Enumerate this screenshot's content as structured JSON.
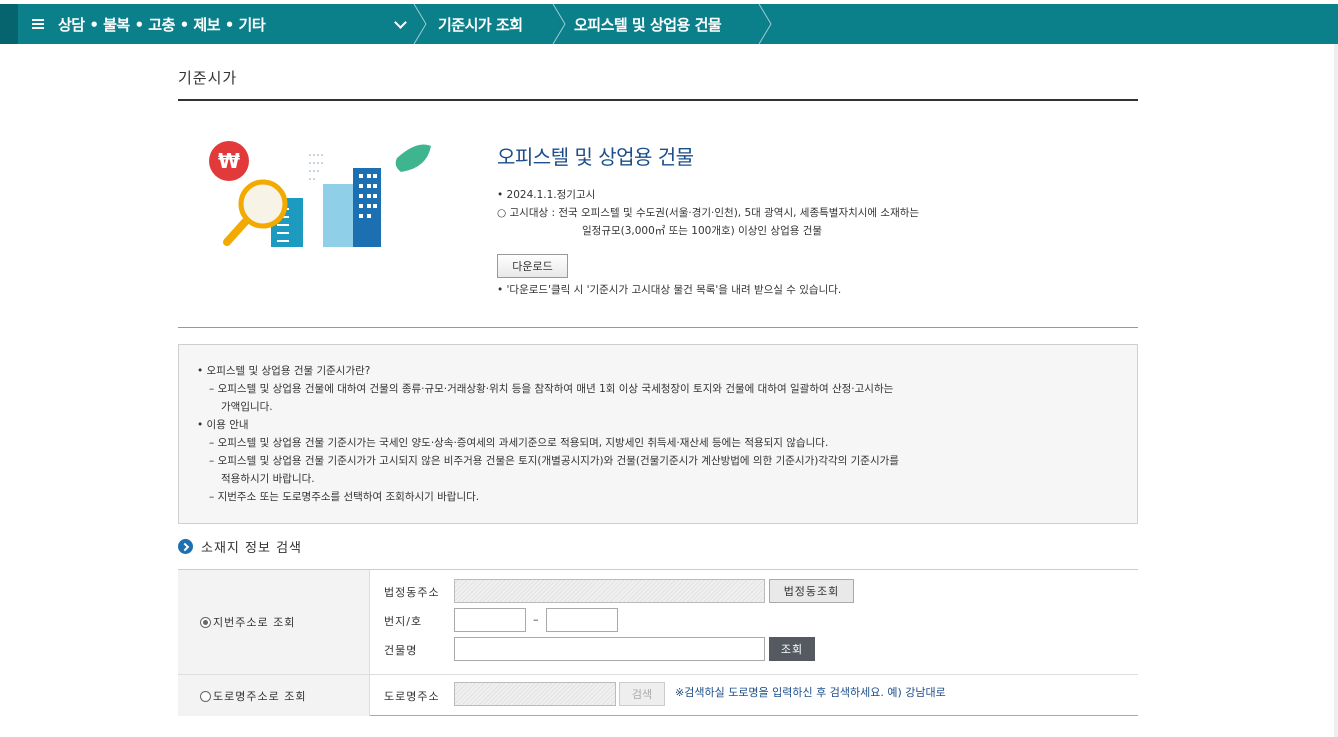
{
  "nav": {
    "menu_label": "상담 • 불복 • 고충 • 제보 • 기타",
    "crumbs": [
      "기준시가 조회",
      "오피스텔 및 상업용 건물"
    ]
  },
  "page": {
    "title": "기준시가"
  },
  "intro": {
    "title": "오피스텔 및 상업용 건물",
    "line1": "• 2024.1.1.정기고시",
    "line2": "○ 고시대상 : 전국 오피스텔 및 수도권(서울·경기·인천), 5대 광역시, 세종특별자치시에 소재하는",
    "line3": "일정규모(3,000㎡ 또는 100개호) 이상인 상업용 건물",
    "download_label": "다운로드",
    "download_note": "• '다운로드'클릭 시 '기준시가 고시대상 물건 목록'을 내려 받으실 수 있습니다."
  },
  "info": {
    "lines": [
      "• 오피스텔 및 상업용 건물 기준시가란?",
      "– 오피스텔 및 상업용 건물에 대하여 건물의 종류·규모·거래상황·위치 등을 참작하여 매년 1회 이상 국세청장이 토지와 건물에 대하여 일괄하여 산정·고시하는",
      "가액입니다.",
      "• 이용 안내",
      "– 오피스텔 및 상업용 건물 기준시가는 국세인 양도·상속·증여세의 과세기준으로 적용되며, 지방세인 취득세·재산세 등에는 적용되지 않습니다.",
      "– 오피스텔 및 상업용 건물 기준시가가 고시되지 않은 비주거용 건물은 토지(개별공시지가)와 건물(건물기준시가 계산방법에 의한 기준시가)각각의 기준시가를",
      "적용하시기 바랍니다.",
      "– 지번주소 또는 도로명주소를 선택하여 조회하시기 바랍니다."
    ]
  },
  "search": {
    "heading": "소재지 정보 검색",
    "jibun_radio": "지번주소로 조회",
    "legal_addr_label": "법정동주소",
    "legal_addr_button": "법정동조회",
    "lot_label": "번지/호",
    "lot_dash": "–",
    "building_label": "건물명",
    "search_button": "조회",
    "road_radio": "도로명주소로 조회",
    "road_label": "도로명주소",
    "road_button": "검색",
    "road_note": "※검색하실 도로명을 입력하신 후 검색하세요. 예) 강남대로"
  },
  "colors": {
    "nav": "#0b7f8a",
    "title": "#1c4e8a",
    "accent_blue": "#1c6fb0"
  }
}
